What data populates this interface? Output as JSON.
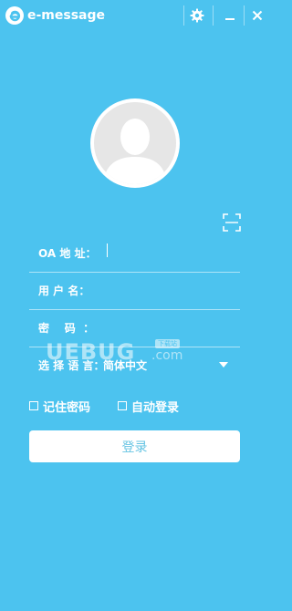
{
  "titlebar": {
    "app_title": "e-message",
    "logo_icon": "e-logo-icon",
    "settings_icon": "gear-icon",
    "minimize_icon": "minimize-icon",
    "close_icon": "close-icon"
  },
  "avatar": {
    "icon": "default-avatar-icon"
  },
  "qr": {
    "icon": "scan-icon"
  },
  "form": {
    "oa_address_label": "OA 地 址：",
    "oa_address_value": "",
    "username_label": "用 户 名：",
    "username_value": "",
    "password_label": "密    码  ：",
    "password_value": "",
    "language_label": "选 择 语 言：",
    "language_value": "简体中文"
  },
  "options": {
    "remember_password": "记住密码",
    "remember_password_checked": false,
    "auto_login": "自动登录",
    "auto_login_checked": false
  },
  "login_button": "登录",
  "watermark": {
    "text": "UEBUG",
    "suffix": ".com",
    "badge": "下载站"
  },
  "colors": {
    "background": "#4cc3ef",
    "button_text": "#66c4e3",
    "avatar_bg": "#e6e6e6"
  }
}
